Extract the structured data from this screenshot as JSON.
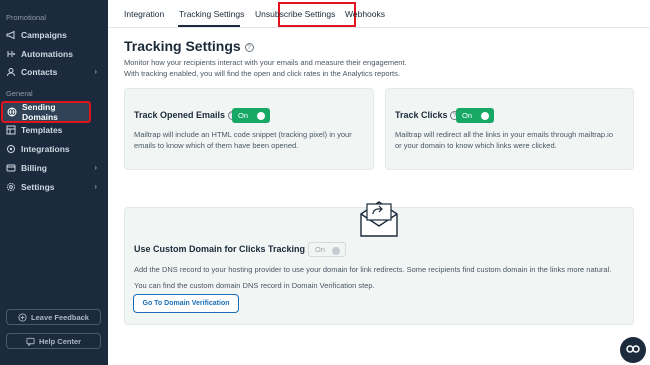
{
  "sidebar": {
    "sections": [
      "Promotional",
      "General"
    ],
    "items": [
      {
        "label": "Campaigns",
        "icon": "megaphone-icon"
      },
      {
        "label": "Automations",
        "icon": "automation-icon"
      },
      {
        "label": "Contacts",
        "icon": "contacts-icon"
      },
      {
        "label": "Sending Domains",
        "icon": "globe-icon"
      },
      {
        "label": "Templates",
        "icon": "templates-icon"
      },
      {
        "label": "Integrations",
        "icon": "integrations-icon"
      },
      {
        "label": "Billing",
        "icon": "billing-icon"
      },
      {
        "label": "Settings",
        "icon": "gear-icon"
      }
    ],
    "leave_feedback": "Leave Feedback",
    "help_center": "Help Center"
  },
  "tabs": [
    "Integration",
    "Tracking Settings",
    "Unsubscribe Settings",
    "Webhooks"
  ],
  "active_tab": "Tracking Settings",
  "main": {
    "title": "Tracking Settings",
    "intro_line1": "Monitor how your recipients interact with your emails and measure their engagement.",
    "intro_line2": "With tracking enabled, you will find the open and click rates in the Analytics reports.",
    "open_card": {
      "title": "Track Opened Emails",
      "toggle": "On",
      "text_line1": "Mailtrap will include an HTML code snippet (tracking pixel) in your",
      "text_line2": "emails to know which of them have been opened."
    },
    "click_card": {
      "title": "Track Clicks",
      "toggle": "On",
      "text_line1": "Mailtrap will redirect all the links in your emails through mailtrap.io",
      "text_line2": "or your domain to know which links were clicked."
    },
    "custom_domain": {
      "title": "Use Custom Domain for Clicks Tracking",
      "toggle": "On",
      "text_line1": "Add the DNS record to your hosting provider to use your domain for link redirects. Some recipients find custom domain in the links more natural.",
      "text_line2": "You can find the custom domain DNS record in Domain Verification step.",
      "button": "Go To Domain Verification"
    }
  },
  "colors": {
    "sidebar_bg": "#1b2a3d",
    "toggle_on": "#17a865",
    "highlight": "#e0141e",
    "link_blue": "#1d6fb8"
  }
}
